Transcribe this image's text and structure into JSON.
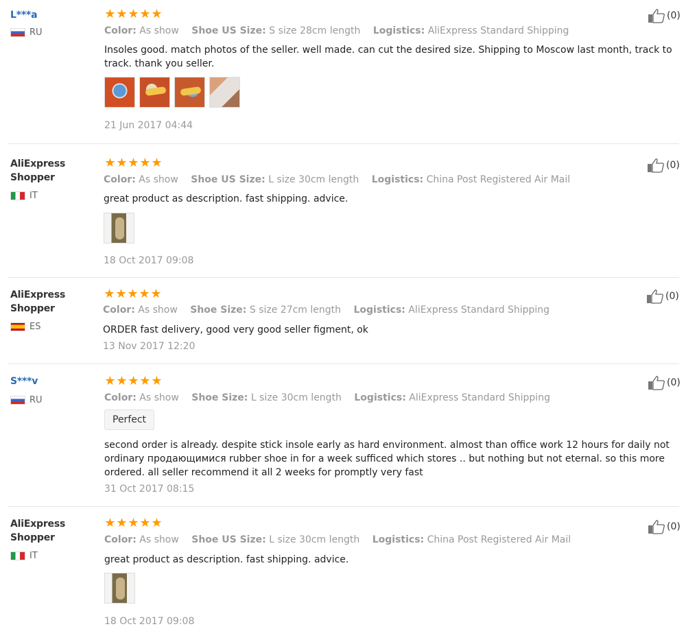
{
  "reviews": [
    {
      "user": "L***a",
      "country": "RU",
      "stars": 5,
      "color_label": "Color:",
      "color_value": "As show",
      "size_label": "Shoe US Size:",
      "size_value": "S size 28cm length",
      "logistics_label": "Logistics:",
      "logistics_value": "AliExpress Standard Shipping",
      "text": "Insoles good. match photos of the seller. well made. can cut the desired size. Shipping to Moscow last month, track to track. thank you seller.",
      "date": "21 Jun 2017 04:44",
      "likes": "(0)"
    },
    {
      "user": "AliExpress Shopper",
      "country": "IT",
      "stars": 5,
      "color_label": "Color:",
      "color_value": "As show",
      "size_label": "Shoe US Size:",
      "size_value": "L size 30cm length",
      "logistics_label": "Logistics:",
      "logistics_value": "China Post Registered Air Mail",
      "text": "great product as description. fast shipping. advice.",
      "date": "18 Oct 2017 09:08",
      "likes": "(0)"
    },
    {
      "user": "AliExpress Shopper",
      "country": "ES",
      "stars": 5,
      "color_label": "Color:",
      "color_value": "As show",
      "size_label": "Shoe Size:",
      "size_value": "S size 27cm length",
      "logistics_label": "Logistics:",
      "logistics_value": "AliExpress Standard Shipping",
      "text": "ORDER fast delivery, good very good seller figment, ok",
      "date": "13 Nov 2017 12:20",
      "likes": "(0)"
    },
    {
      "user": "S***v",
      "country": "RU",
      "stars": 5,
      "color_label": "Color:",
      "color_value": "As show",
      "size_label": "Shoe Size:",
      "size_value": "L size 30cm length",
      "logistics_label": "Logistics:",
      "logistics_value": "AliExpress Standard Shipping",
      "tag": "Perfect",
      "text": "second order is already. despite stick insole early as hard environment. almost than office work 12 hours for daily not ordinary продающимися rubber shoe in for a week sufficed which stores .. but nothing but not eternal. so this more ordered. all seller recommend it all 2 weeks for promptly very fast",
      "date": "31 Oct 2017 08:15",
      "likes": "(0)"
    },
    {
      "user": "AliExpress Shopper",
      "country": "IT",
      "stars": 5,
      "color_label": "Color:",
      "color_value": "As show",
      "size_label": "Shoe US Size:",
      "size_value": "L size 30cm length",
      "logistics_label": "Logistics:",
      "logistics_value": "China Post Registered Air Mail",
      "text": "great product as description. fast shipping. advice.",
      "date": "18 Oct 2017 09:08",
      "likes": "(0)"
    }
  ],
  "colors": {
    "star": "#ff9a00",
    "masked_user": "#2a6bb5",
    "meta": "#999999"
  },
  "icons": {
    "rating": "star-icon",
    "like": "thumbs-up-icon"
  }
}
